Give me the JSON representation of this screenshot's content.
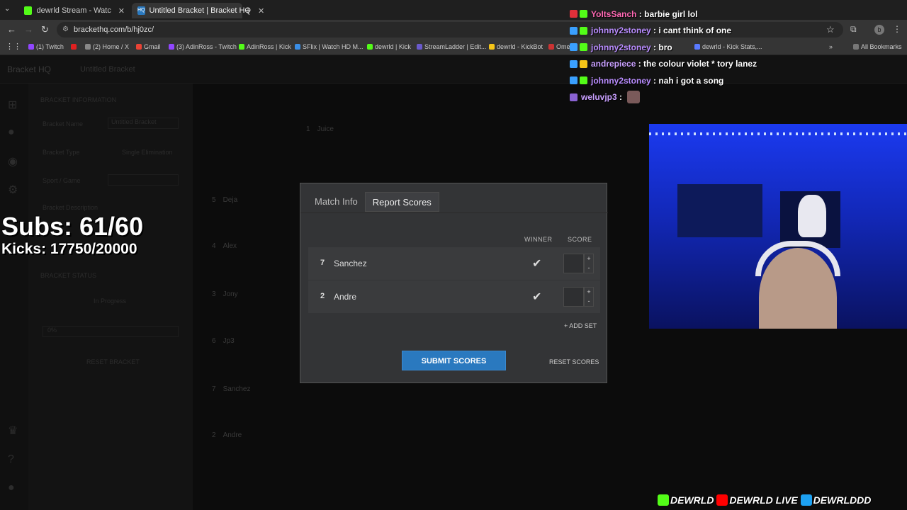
{
  "browser": {
    "tabs": [
      {
        "title": "dewrld Stream - Watch Live on",
        "color": "#53fc18"
      },
      {
        "title": "Untitled Bracket | Bracket HQ",
        "color": "#2a79bf"
      }
    ],
    "url": "brackethq.com/b/hj0zc/",
    "profile_initial": "b",
    "bookmarks": [
      {
        "label": "(1) Twitch",
        "color": "#9146ff"
      },
      {
        "label": "",
        "color": "#e02020"
      },
      {
        "label": "(2) Home / X",
        "color": "#888888"
      },
      {
        "label": "Gmail",
        "color": "#ea4335"
      },
      {
        "label": "(3) AdinRoss - Twitch",
        "color": "#9146ff"
      },
      {
        "label": "AdinRoss | Kick",
        "color": "#53fc18"
      },
      {
        "label": "SFlix | Watch HD M...",
        "color": "#3a8ee6"
      },
      {
        "label": "dewrld | Kick",
        "color": "#53fc18"
      },
      {
        "label": "StreamLadder | Edit...",
        "color": "#6a5acd"
      },
      {
        "label": "dewrld - KickBot",
        "color": "#f5c518"
      },
      {
        "label": "Ome",
        "color": "#cc3333"
      },
      {
        "label": "dewrld - Kick Stats,...",
        "color": "#5a7aff"
      }
    ],
    "all_bookmarks": "All Bookmarks"
  },
  "app": {
    "logo": "Bracket HQ",
    "bracket_name": "Untitled Bracket",
    "side": {
      "section1": "BRACKET INFORMATION",
      "name_label": "Bracket Name",
      "name_value": "Untitled Bracket",
      "type_label": "Bracket Type",
      "type_value": "Single Elimination",
      "sport_label": "Sport / Game",
      "desc_label": "Bracket Description",
      "section2": "BRACKET STATUS",
      "status_value": "In Progress",
      "percent": "0%",
      "reset_bracket": "RESET BRACKET"
    },
    "seeds": [
      {
        "seed": "1",
        "name": "Juice"
      },
      {
        "seed": "5",
        "name": "Deja"
      },
      {
        "seed": "4",
        "name": "Alex"
      },
      {
        "seed": "3",
        "name": "Jony"
      },
      {
        "seed": "6",
        "name": "Jp3"
      },
      {
        "seed": "7",
        "name": "Sanchez"
      },
      {
        "seed": "2",
        "name": "Andre"
      }
    ]
  },
  "modal": {
    "tabs": [
      "Match Info",
      "Report Scores"
    ],
    "winner_header": "WINNER",
    "score_header": "SCORE",
    "players": [
      {
        "seed": "7",
        "name": "Sanchez"
      },
      {
        "seed": "2",
        "name": "Andre"
      }
    ],
    "add_set": "+ ADD SET",
    "submit": "SUBMIT SCORES",
    "reset": "RESET SCORES"
  },
  "overlay": {
    "subs": "Subs: 61/60",
    "kicks": "Kicks: 17750/20000",
    "chat": [
      {
        "user": "YoItsSanch",
        "msg": "barbie girl lol",
        "color": "#ff69b4"
      },
      {
        "user": "johnny2stoney",
        "msg": "i cant think of one",
        "color": "#b98cff"
      },
      {
        "user": "johnny2stoney",
        "msg": "bro",
        "color": "#b98cff"
      },
      {
        "user": "andrepiece",
        "msg": "the colour violet * tory lanez",
        "color": "#c9a0ff"
      },
      {
        "user": "johnny2stoney",
        "msg": "nah i got a song",
        "color": "#b98cff"
      },
      {
        "user": "weluvjp3",
        "msg": "",
        "color": "#c9a0ff"
      }
    ],
    "socials": [
      "DEWRLD",
      "DEWRLD LIVE",
      "DEWRLDDD"
    ]
  }
}
